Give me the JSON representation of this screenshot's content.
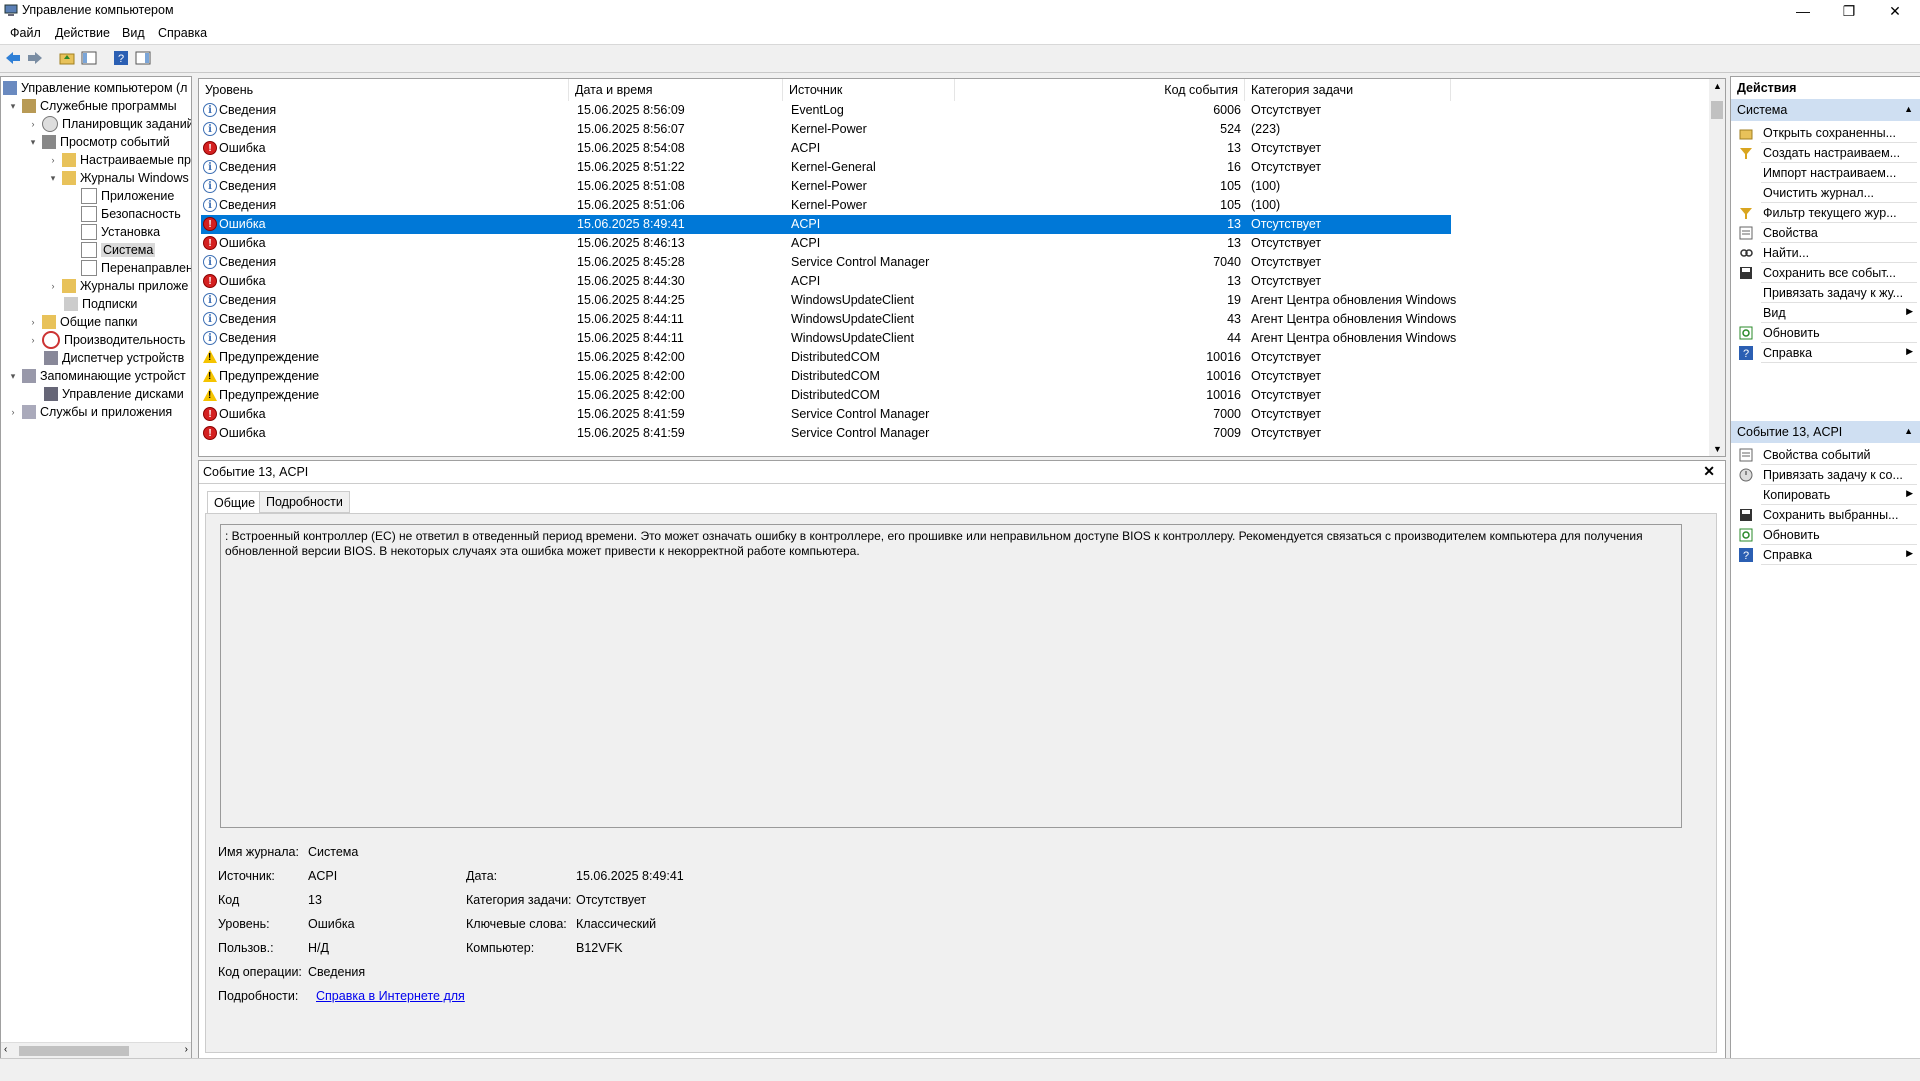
{
  "window": {
    "title": "Управление компьютером",
    "minimize": "—",
    "restore": "❐",
    "close": "✕"
  },
  "menu": [
    "Файл",
    "Действие",
    "Вид",
    "Справка"
  ],
  "tree": [
    {
      "label": "Управление компьютером (л",
      "icon": "computer-icon",
      "exp": ""
    },
    {
      "label": "Служебные программы",
      "icon": "tools-icon",
      "exp": "v"
    },
    {
      "label": "Планировщик заданий",
      "icon": "clock-icon",
      "exp": ">"
    },
    {
      "label": "Просмотр событий",
      "icon": "event-viewer-icon",
      "exp": "v"
    },
    {
      "label": "Настраиваемые пр",
      "icon": "folder-icon",
      "exp": ">"
    },
    {
      "label": "Журналы Windows",
      "icon": "folder-icon",
      "exp": "v"
    },
    {
      "label": "Приложение",
      "icon": "log-icon",
      "exp": ""
    },
    {
      "label": "Безопасность",
      "icon": "log-icon",
      "exp": ""
    },
    {
      "label": "Установка",
      "icon": "log-icon",
      "exp": ""
    },
    {
      "label": "Система",
      "icon": "log-icon",
      "exp": ""
    },
    {
      "label": "Перенаправлен",
      "icon": "log-icon",
      "exp": ""
    },
    {
      "label": "Журналы приложе",
      "icon": "folder-icon",
      "exp": ">"
    },
    {
      "label": "Подписки",
      "icon": "subscriptions-icon",
      "exp": ""
    },
    {
      "label": "Общие папки",
      "icon": "shared-folder-icon",
      "exp": ">"
    },
    {
      "label": "Производительность",
      "icon": "performance-icon",
      "exp": ">"
    },
    {
      "label": "Диспетчер устройств",
      "icon": "device-manager-icon",
      "exp": ""
    },
    {
      "label": "Запоминающие устройст",
      "icon": "storage-icon",
      "exp": "v"
    },
    {
      "label": "Управление дисками",
      "icon": "disk-icon",
      "exp": ""
    },
    {
      "label": "Службы и приложения",
      "icon": "services-icon",
      "exp": ">"
    }
  ],
  "events": {
    "columns": [
      "Уровень",
      "Дата и время",
      "Источник",
      "Код события",
      "Категория задачи"
    ],
    "rows": [
      {
        "level": "Сведения",
        "type": "info",
        "date": "15.06.2025 8:56:09",
        "source": "EventLog",
        "code": "6006",
        "category": "Отсутствует"
      },
      {
        "level": "Сведения",
        "type": "info",
        "date": "15.06.2025 8:56:07",
        "source": "Kernel-Power",
        "code": "524",
        "category": "(223)"
      },
      {
        "level": "Ошибка",
        "type": "error",
        "date": "15.06.2025 8:54:08",
        "source": "ACPI",
        "code": "13",
        "category": "Отсутствует"
      },
      {
        "level": "Сведения",
        "type": "info",
        "date": "15.06.2025 8:51:22",
        "source": "Kernel-General",
        "code": "16",
        "category": "Отсутствует"
      },
      {
        "level": "Сведения",
        "type": "info",
        "date": "15.06.2025 8:51:08",
        "source": "Kernel-Power",
        "code": "105",
        "category": "(100)"
      },
      {
        "level": "Сведения",
        "type": "info",
        "date": "15.06.2025 8:51:06",
        "source": "Kernel-Power",
        "code": "105",
        "category": "(100)"
      },
      {
        "level": "Ошибка",
        "type": "error",
        "date": "15.06.2025 8:49:41",
        "source": "ACPI",
        "code": "13",
        "category": "Отсутствует",
        "selected": true
      },
      {
        "level": "Ошибка",
        "type": "error",
        "date": "15.06.2025 8:46:13",
        "source": "ACPI",
        "code": "13",
        "category": "Отсутствует"
      },
      {
        "level": "Сведения",
        "type": "info",
        "date": "15.06.2025 8:45:28",
        "source": "Service Control Manager",
        "code": "7040",
        "category": "Отсутствует"
      },
      {
        "level": "Ошибка",
        "type": "error",
        "date": "15.06.2025 8:44:30",
        "source": "ACPI",
        "code": "13",
        "category": "Отсутствует"
      },
      {
        "level": "Сведения",
        "type": "info",
        "date": "15.06.2025 8:44:25",
        "source": "WindowsUpdateClient",
        "code": "19",
        "category": "Агент Центра обновления Windows"
      },
      {
        "level": "Сведения",
        "type": "info",
        "date": "15.06.2025 8:44:11",
        "source": "WindowsUpdateClient",
        "code": "43",
        "category": "Агент Центра обновления Windows"
      },
      {
        "level": "Сведения",
        "type": "info",
        "date": "15.06.2025 8:44:11",
        "source": "WindowsUpdateClient",
        "code": "44",
        "category": "Агент Центра обновления Windows"
      },
      {
        "level": "Предупреждение",
        "type": "warn",
        "date": "15.06.2025 8:42:00",
        "source": "DistributedCOM",
        "code": "10016",
        "category": "Отсутствует"
      },
      {
        "level": "Предупреждение",
        "type": "warn",
        "date": "15.06.2025 8:42:00",
        "source": "DistributedCOM",
        "code": "10016",
        "category": "Отсутствует"
      },
      {
        "level": "Предупреждение",
        "type": "warn",
        "date": "15.06.2025 8:42:00",
        "source": "DistributedCOM",
        "code": "10016",
        "category": "Отсутствует"
      },
      {
        "level": "Ошибка",
        "type": "error",
        "date": "15.06.2025 8:41:59",
        "source": "Service Control Manager",
        "code": "7000",
        "category": "Отсутствует"
      },
      {
        "level": "Ошибка",
        "type": "error",
        "date": "15.06.2025 8:41:59",
        "source": "Service Control Manager",
        "code": "7009",
        "category": "Отсутствует"
      }
    ]
  },
  "detail": {
    "title": "Событие 13, ACPI",
    "tabs": [
      "Общие",
      "Подробности"
    ],
    "description": ": Встроенный контроллер (EC) не ответил в отведенный период времени. Это может означать ошибку в контроллере, его прошивке или неправильном доступе BIOS к контроллеру. Рекомендуется связаться с производителем компьютера для получения обновленной версии BIOS. В некоторых случаях эта ошибка может привести к некорректной работе компьютера.",
    "fields": {
      "log_label": "Имя журнала:",
      "log_value": "Система",
      "source_label": "Источник:",
      "source_value": "ACPI",
      "date_label": "Дата:",
      "date_value": "15.06.2025 8:49:41",
      "code_label": "Код",
      "code_value": "13",
      "category_label": "Категория задачи:",
      "category_value": "Отсутствует",
      "level_label": "Уровень:",
      "level_value": "Ошибка",
      "keywords_label": "Ключевые слова:",
      "keywords_value": "Классический",
      "user_label": "Пользов.:",
      "user_value": "Н/Д",
      "computer_label": "Компьютер:",
      "computer_value": "B12VFK",
      "opcode_label": "Код операции:",
      "opcode_value": "Сведения",
      "more_label": "Подробности:",
      "more_link": "Справка в Интернете для"
    }
  },
  "actions": {
    "header": "Действия",
    "section1": "Система",
    "items1": [
      {
        "label": "Открыть сохраненны...",
        "icon": "open-folder-icon"
      },
      {
        "label": "Создать настраиваем...",
        "icon": "filter-icon"
      },
      {
        "label": "Импорт настраиваем...",
        "icon": ""
      },
      {
        "label": "Очистить журнал...",
        "icon": ""
      },
      {
        "label": "Фильтр текущего жур...",
        "icon": "filter-icon"
      },
      {
        "label": "Свойства",
        "icon": "properties-icon"
      },
      {
        "label": "Найти...",
        "icon": "find-icon"
      },
      {
        "label": "Сохранить все событ...",
        "icon": "save-icon"
      },
      {
        "label": "Привязать задачу к жу...",
        "icon": ""
      },
      {
        "label": "Вид",
        "icon": "",
        "sub": true
      },
      {
        "label": "Обновить",
        "icon": "refresh-icon"
      },
      {
        "label": "Справка",
        "icon": "help-icon",
        "sub": true
      }
    ],
    "section2": "Событие 13, ACPI",
    "items2": [
      {
        "label": "Свойства событий",
        "icon": "properties-icon"
      },
      {
        "label": "Привязать задачу к со...",
        "icon": "task-icon"
      },
      {
        "label": "Копировать",
        "icon": "",
        "sub": true
      },
      {
        "label": "Сохранить выбранны...",
        "icon": "save-icon"
      },
      {
        "label": "Обновить",
        "icon": "refresh-icon"
      },
      {
        "label": "Справка",
        "icon": "help-icon",
        "sub": true
      }
    ]
  }
}
